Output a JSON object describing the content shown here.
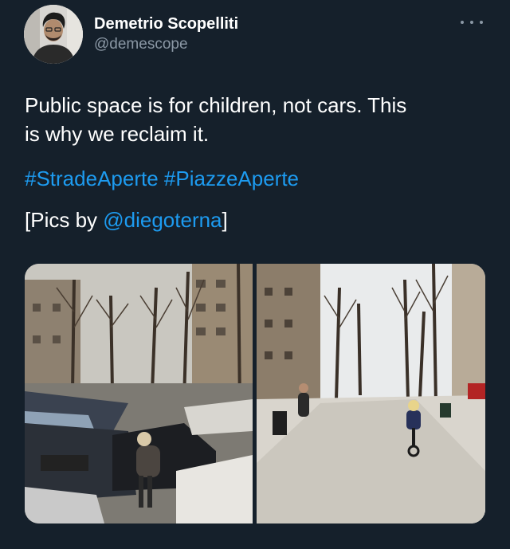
{
  "user": {
    "display_name": "Demetrio Scopelliti",
    "handle": "@demescope",
    "avatar_icon": "profile-photo"
  },
  "more_icon": "more-dots-icon",
  "tweet": {
    "text_line1": "Public space is for children, not cars. This",
    "text_line2": "is why we reclaim it.",
    "hashtag1": "#StradeAperte",
    "hashtag2": "#PiazzeAperte",
    "credits_prefix": "[Pics by ",
    "credits_mention": "@diegoterna",
    "credits_suffix": "]"
  },
  "media": {
    "photos": [
      "street-with-parked-cars",
      "street-reclaimed-child-cycling"
    ]
  },
  "colors": {
    "background": "#15202b",
    "link": "#1d9bf0",
    "secondary_text": "#8b98a5"
  }
}
